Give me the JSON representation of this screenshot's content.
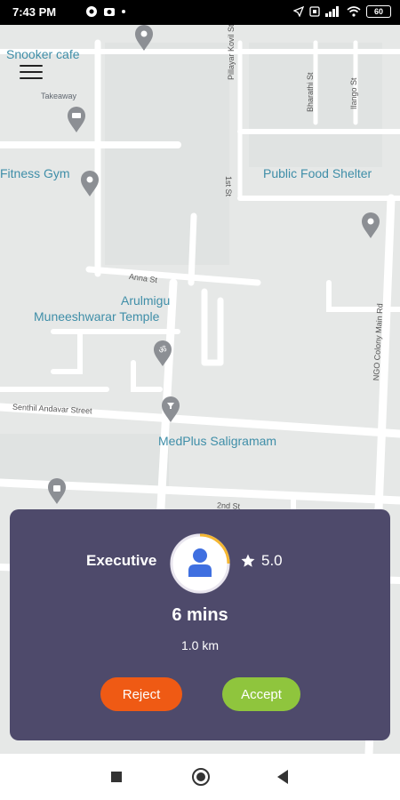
{
  "status_bar": {
    "time": "7:43 PM",
    "battery": "60"
  },
  "map": {
    "places": {
      "snooker": "Snooker cafe",
      "takeaway": "Takeaway",
      "fitness": "Fitness Gym",
      "food_shelter": "Public Food Shelter",
      "temple_line1": "Arulmigu",
      "temple_line2": "Muneeshwarar Temple",
      "medplus": "MedPlus Saligramam"
    },
    "streets": {
      "pillayar": "Pillayar Kovil St",
      "first": "1st St",
      "bharathi": "Bharathi St",
      "ilango": "Ilango St",
      "anna": "Anna St",
      "senthil": "Senthil Andavar Street",
      "ngo": "NGO Colony Main Rd",
      "second": "2nd St"
    }
  },
  "card": {
    "vehicle_type": "Executive",
    "rating": "5.0",
    "eta": "6 mins",
    "distance": "1.0 km",
    "reject_label": "Reject",
    "accept_label": "Accept",
    "colors": {
      "background": "#4e4a6b",
      "reject": "#ef5a14",
      "accept": "#8fc53d",
      "avatar": "#3f6fe0",
      "ring": "#f5b731"
    }
  },
  "icons": {
    "menu": "hamburger-icon",
    "star": "star-icon",
    "avatar": "user-icon",
    "nav_recent": "square-icon",
    "nav_home": "circle-icon",
    "nav_back": "triangle-back-icon"
  }
}
